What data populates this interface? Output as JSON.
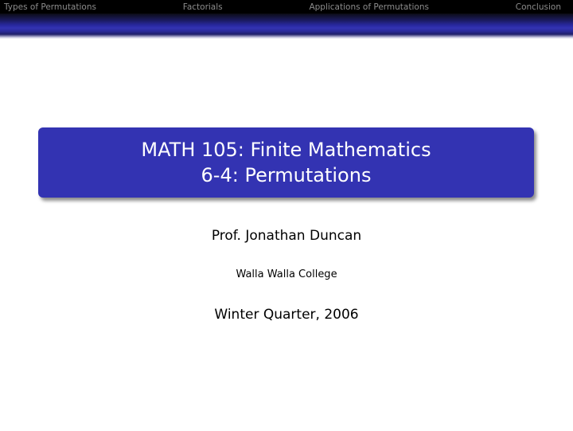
{
  "nav": {
    "items": [
      {
        "label": "Types of Permutations"
      },
      {
        "label": "Factorials"
      },
      {
        "label": "Applications of Permutations"
      },
      {
        "label": "Conclusion"
      }
    ]
  },
  "title": {
    "line1": "MATH 105: Finite Mathematics",
    "line2": "6-4: Permutations"
  },
  "author": "Prof. Jonathan Duncan",
  "institute": "Walla Walla College",
  "date": "Winter Quarter, 2006",
  "colors": {
    "nav_background": "#000000",
    "nav_text": "#8c8c8c",
    "title_block": "#3333b2",
    "title_text": "#ffffff"
  }
}
